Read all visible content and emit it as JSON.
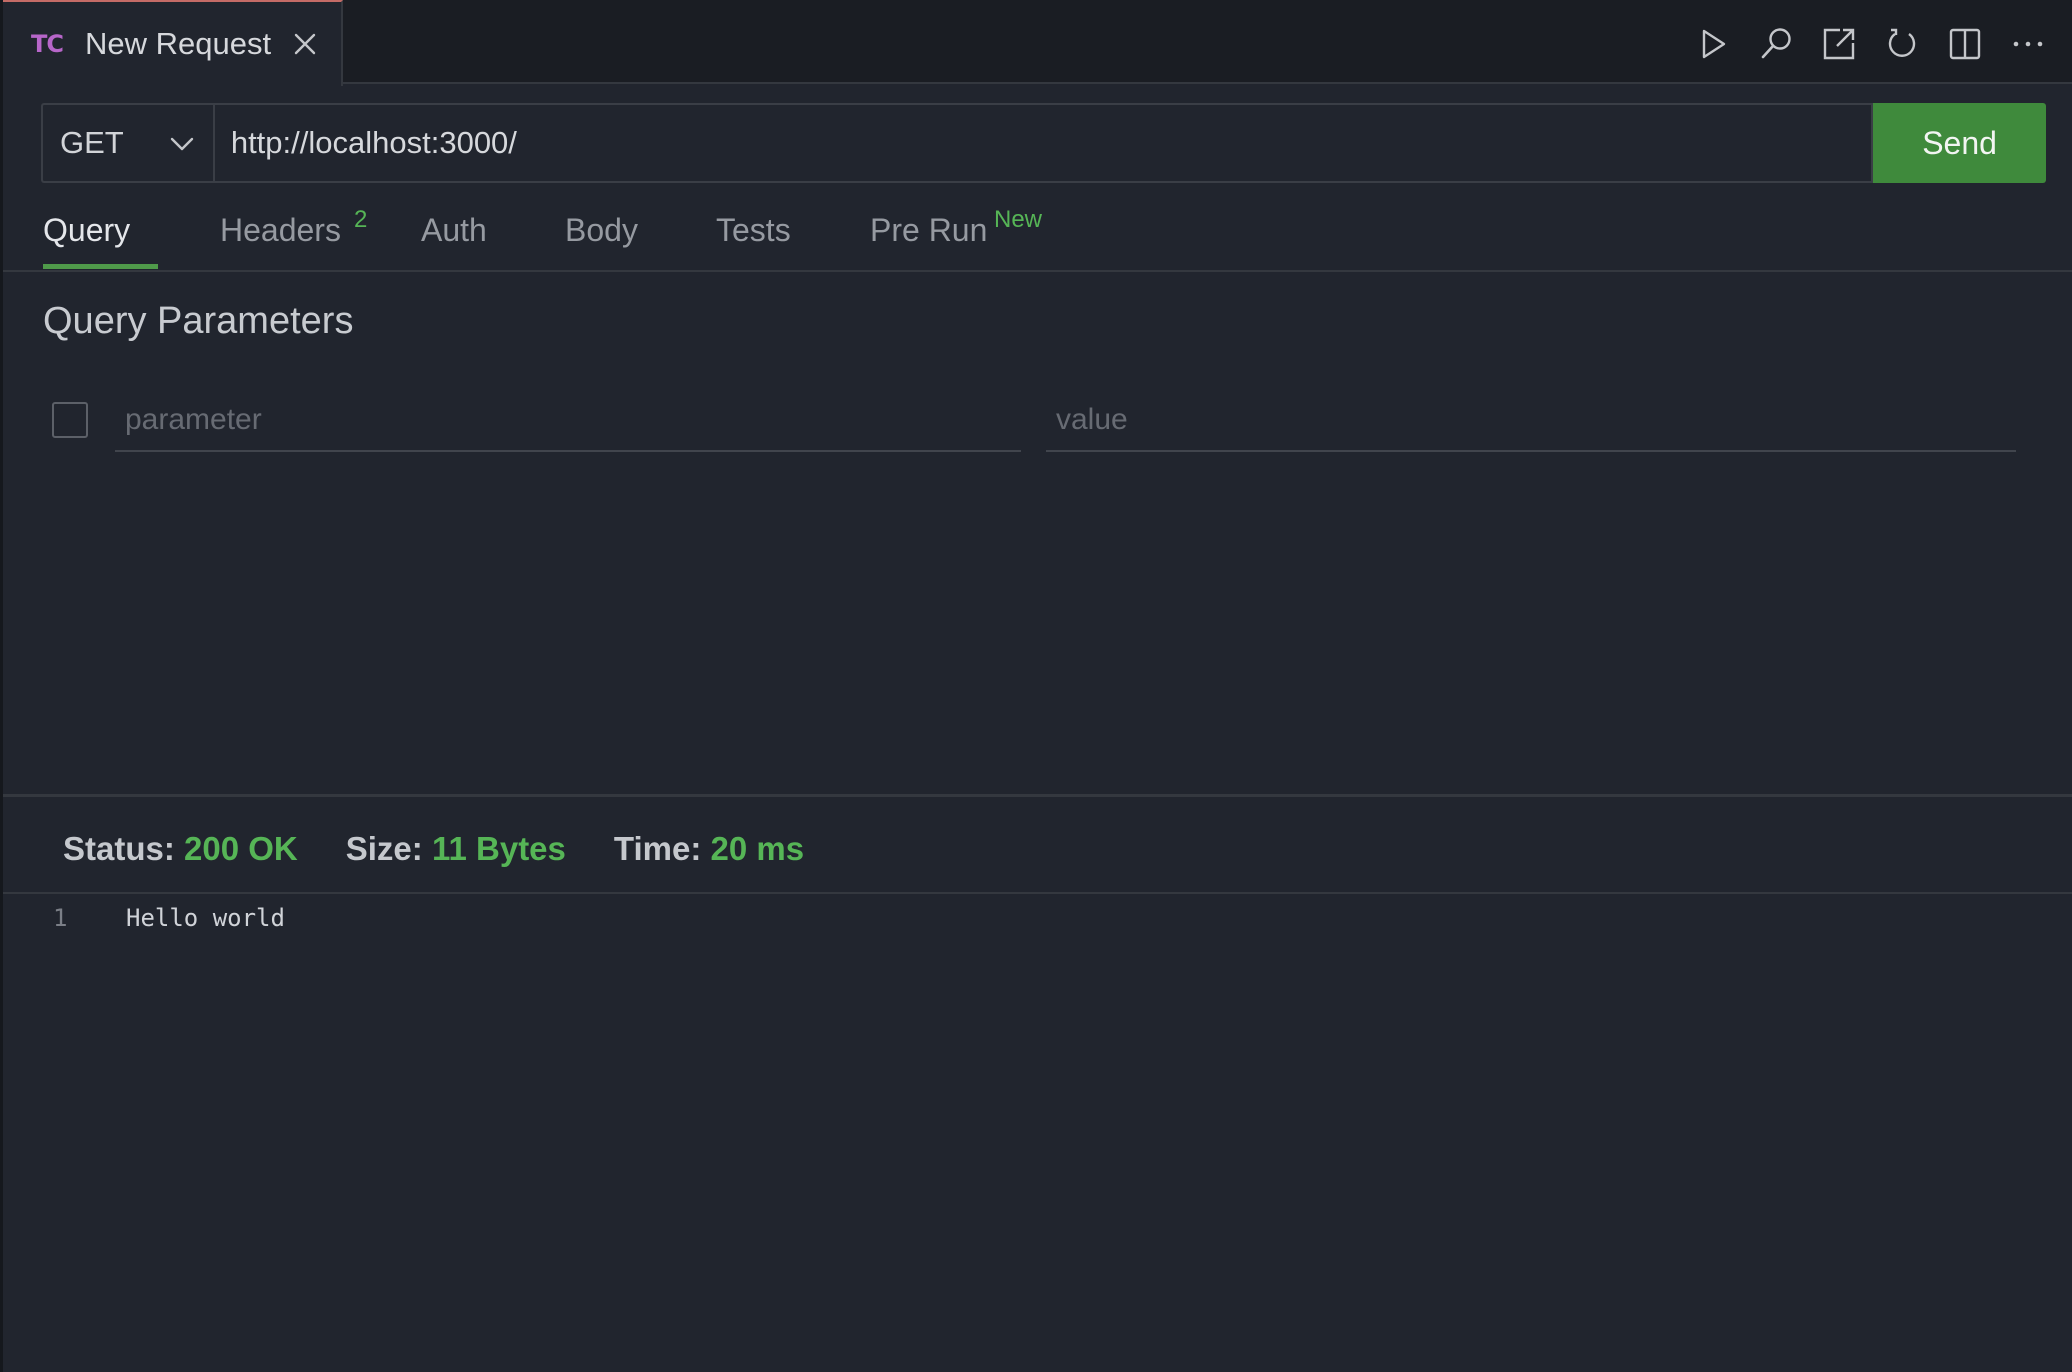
{
  "tab": {
    "logo": "TC",
    "title": "New Request"
  },
  "toolbar": {
    "icons": [
      "run-icon",
      "search-icon",
      "open-external-icon",
      "refresh-icon",
      "split-view-icon",
      "more-icon"
    ]
  },
  "request": {
    "method": "GET",
    "url": "http://localhost:3000/",
    "send_label": "Send"
  },
  "subtabs": [
    {
      "label": "Query",
      "badge": "",
      "active": true
    },
    {
      "label": "Headers",
      "badge": "2",
      "active": false
    },
    {
      "label": "Auth",
      "badge": "",
      "active": false
    },
    {
      "label": "Body",
      "badge": "",
      "active": false
    },
    {
      "label": "Tests",
      "badge": "",
      "active": false
    },
    {
      "label": "Pre Run",
      "badge": "New",
      "active": false
    }
  ],
  "query": {
    "title": "Query Parameters",
    "param_placeholder": "parameter",
    "value_placeholder": "value"
  },
  "response": {
    "status_label": "Status:",
    "status_value": "200 OK",
    "size_label": "Size:",
    "size_value": "11 Bytes",
    "time_label": "Time:",
    "time_value": "20 ms",
    "lines": [
      {
        "no": "1",
        "text": "Hello world"
      }
    ]
  },
  "colors": {
    "accent_green": "#3f8a3c",
    "success_text": "#56b556",
    "logo_purple": "#b766c9",
    "background": "#21252e"
  }
}
